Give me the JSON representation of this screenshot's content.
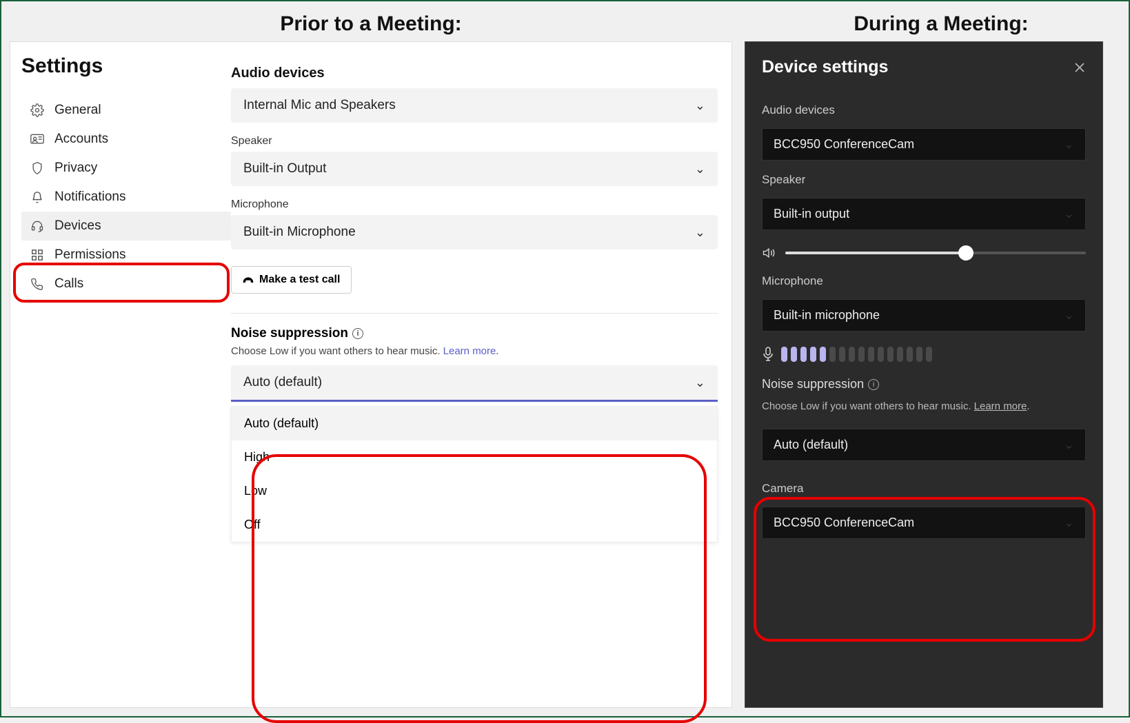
{
  "captions": {
    "prior": "Prior to a Meeting:",
    "during": "During a Meeting:"
  },
  "light": {
    "title": "Settings",
    "nav": {
      "general": "General",
      "accounts": "Accounts",
      "privacy": "Privacy",
      "notifications": "Notifications",
      "devices": "Devices",
      "permissions": "Permissions",
      "calls": "Calls"
    },
    "audio_devices_heading": "Audio devices",
    "audio_devices_value": "Internal Mic and Speakers",
    "speaker_label": "Speaker",
    "speaker_value": "Built-in Output",
    "microphone_label": "Microphone",
    "microphone_value": "Built-in Microphone",
    "test_call": "Make a test call",
    "noise_suppression": {
      "heading": "Noise suppression",
      "desc_pre": "Choose Low if you want others to hear music. ",
      "learn_more": "Learn more",
      "desc_post": ".",
      "selected": "Auto (default)",
      "options": [
        "Auto (default)",
        "High",
        "Low",
        "Off"
      ]
    }
  },
  "dark": {
    "title": "Device settings",
    "audio_devices_label": "Audio devices",
    "audio_devices_value": "BCC950 ConferenceCam",
    "speaker_label": "Speaker",
    "speaker_value": "Built-in output",
    "microphone_label": "Microphone",
    "microphone_value": "Built-in microphone",
    "mic_level_lit": 5,
    "mic_level_total": 16,
    "noise_suppression": {
      "heading": "Noise suppression",
      "desc": "Choose Low if you want others to hear music. ",
      "learn_more": "Learn more",
      "desc_post": ".",
      "value": "Auto (default)"
    },
    "camera_label": "Camera",
    "camera_value": "BCC950 ConferenceCam"
  }
}
